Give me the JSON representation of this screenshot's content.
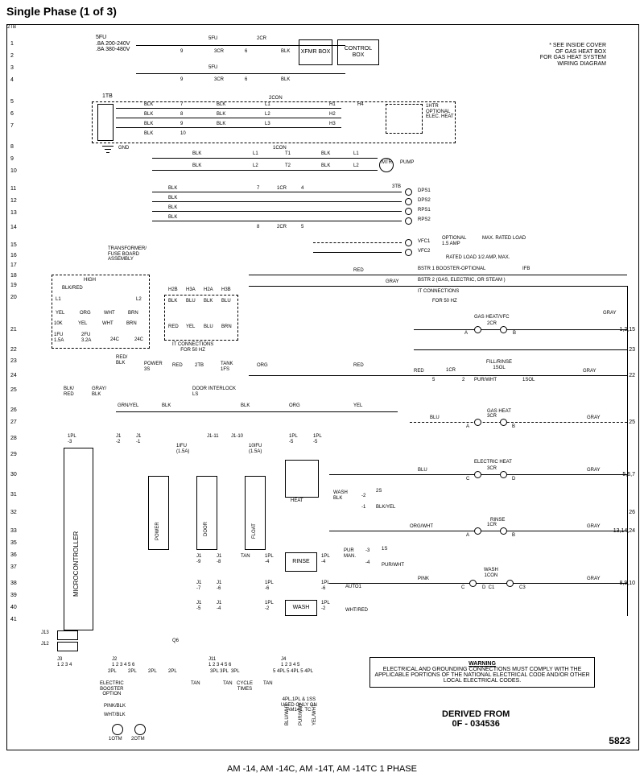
{
  "title": "Single Phase (1 of 3)",
  "footer": "AM -14, AM -14C, AM -14T, AM -14TC 1 PHASE",
  "drawing_number": "5823",
  "derived": "DERIVED FROM\n0F - 034536",
  "note_top": "* SEE INSIDE COVER\nOF GAS HEAT BOX\nFOR GAS HEAT SYSTEM\nWIRING DIAGRAM",
  "warning": {
    "heading": "WARNING",
    "body": "ELECTRICAL AND GROUNDING CONNECTIONS MUST\nCOMPLY WITH THE APPLICABLE PORTIONS OF THE\nNATIONAL ELECTRICAL CODE AND/OR OTHER LOCAL\nELECTRICAL CODES."
  },
  "row_numbers_left": [
    "1",
    "2",
    "3",
    "4",
    "5",
    "6",
    "7",
    "8",
    "9",
    "10",
    "11",
    "12",
    "13",
    "14",
    "15",
    "16",
    "17",
    "18",
    "19",
    "20",
    "21",
    "22",
    "23",
    "24",
    "25",
    "26",
    "27",
    "28",
    "29",
    "30",
    "31",
    "32",
    "33",
    "35",
    "36",
    "37",
    "38",
    "39",
    "40",
    "41"
  ],
  "row_numbers_right": [
    "23",
    "1,2,15",
    "22",
    "25",
    "5,6,7",
    "26",
    "13,14,24",
    "8,9,10"
  ],
  "header_block": {
    "fuse": "5FU\n.8A 200-240V\n.8A 380-480V",
    "labels": [
      "5FU",
      "5FU",
      "2CR"
    ],
    "wires1": [
      "9",
      "3CR",
      "6",
      "BLK"
    ],
    "wires2": [
      "9",
      "3CR",
      "6",
      "BLK"
    ],
    "xfmr": "XFMR\nBOX",
    "control": "CONTROL\nBOX"
  },
  "tb": {
    "name": "1TB",
    "rows": [
      "BLK",
      "BLK",
      "BLK",
      "BLK"
    ],
    "numbers": [
      "7",
      "8",
      "9",
      "10"
    ],
    "right": [
      "BLK",
      "BLK",
      "BLK",
      "BLK"
    ],
    "con": "2CON",
    "l123": [
      "L1",
      "L2",
      "L3"
    ],
    "h123": [
      "H1",
      "H2",
      "H3"
    ],
    "h4": "H4",
    "htr": "1HTR\nOPTIONAL\nELEC. HEAT",
    "gnd": "GND"
  },
  "midblock": {
    "con": "1CON",
    "lines": [
      [
        "BLK",
        "L1",
        "T1",
        "BLK",
        "L1"
      ],
      [
        "BLK",
        "L2",
        "T2",
        "BLK",
        "L2"
      ]
    ],
    "mtr": "MTR",
    "pump": "PUMP"
  },
  "dps_block": {
    "name": "3TB",
    "items": [
      "DPS1",
      "DPS2",
      "RPS1",
      "RPS2"
    ],
    "wires": [
      "BLK",
      "BLK",
      "BLK",
      "BLK"
    ],
    "mid": [
      "7",
      "1CR",
      "4",
      "8",
      "2CR",
      "5"
    ]
  },
  "vfc": {
    "v1": "VFC1",
    "v2": "VFC2",
    "opt": "OPTIONAL\n1.5 AMP",
    "max": "MAX. RATED LOAD",
    "line2": "RATED LOAD 1/2 AMP, MAX."
  },
  "bstr": {
    "b1": "BSTR 1 BOOSTER-OPTIONAL",
    "b2": "BSTR 2 (GAS, ELECTRIC, OR STEAM )",
    "b3": "IT CONNECTIONS",
    "b4": "FOR 50 HZ"
  },
  "transformer": {
    "title": "TRANSFORMER/\nFUSE BOARD\nASSEMBLY",
    "high": "HIGH",
    "blkred": "BLK/RED",
    "l1l2": [
      "L1",
      "L2"
    ],
    "sub": [
      "YEL",
      "ORG",
      "WHT",
      "BRN"
    ],
    "sub2": [
      "10K",
      "YEL",
      "WHT",
      "BRN"
    ],
    "fuses": [
      "1FU\n1.5A",
      "2FU\n3.2A",
      "24C",
      "24C"
    ],
    "small": "24C"
  },
  "h2b": {
    "cols": [
      "H2B",
      "H3A",
      "H2A",
      "H3B"
    ],
    "row": [
      "BLK",
      "BLU",
      "BLK",
      "BLU"
    ],
    "sec": [
      "RED",
      "YEL",
      "BLU",
      "BRN"
    ],
    "note": "IT CONNECTIONS\nFOR 50 HZ"
  },
  "power_row": {
    "left": [
      "RED/\nBLK",
      "POWER\n3S",
      "RED",
      "2TB",
      "TANK\n1FS",
      "ORG"
    ],
    "right": "RED",
    "row24": [
      "BLK/\nRED",
      "GRAY/\nBLK",
      "DOOR INTERLOCK\nLS"
    ],
    "row25": [
      "GRN/YEL",
      "BLK",
      "2TB",
      "BLK",
      "ORG",
      "YEL"
    ]
  },
  "micro": {
    "label": "MICROCONTROLLER",
    "top": [
      "1PL\n-3",
      "J1\n-2",
      "J1\n-1",
      "1IFU\n(1.5A)",
      "J1-11",
      "J1-10",
      "10IFU\n(1.5A)",
      "1PL\n-5",
      "1PL\n-5"
    ],
    "col_boxes": [
      "POWER",
      "DOOR",
      "FLOAT",
      "HEAT"
    ],
    "right_notes": [
      "WASH\nBLK",
      "-2",
      "2S",
      "-1",
      "BLK/YEL"
    ],
    "rinse": [
      "J1\n-9",
      "J1\n-8",
      "TAN",
      "1PL\n-4",
      "RINSE",
      "1PL\n-4"
    ],
    "purman": [
      "PUR\nMAN.",
      "-3",
      "1S",
      "-4",
      "PUR/WHT"
    ],
    "auto": [
      "J1\n-7",
      "J1\n-6",
      "1PL\n-6",
      "1PL\n-6",
      "AUTO1"
    ],
    "wash": [
      "J1\n-5",
      "J1\n-4",
      "1PL\n-2",
      "WASH",
      "1PL\n-2"
    ],
    "bottom_notes": "WHT/RED"
  },
  "right_rail": {
    "items": [
      {
        "title": "GAS HEAT/VFC",
        "a": "A",
        "b": "B",
        "cr": "2CR",
        "wire": "GRAY"
      },
      {
        "title": "FILL/RINSE\n1SOL",
        "a": "5",
        "b": "1CR",
        "c": "2",
        "wire": "RED",
        "wc": "PUR/WHT",
        "wd": "1SOL",
        "we": "GRAY"
      },
      {
        "title": "GAS HEAT",
        "a": "A",
        "b": "B",
        "cr": "3CR",
        "wire": "BLU",
        "wr": "GRAY"
      },
      {
        "title": "ELECTRIC HEAT",
        "a": "C",
        "b": "D",
        "cr": "3CR",
        "wire": "BLU",
        "wr": "GRAY"
      },
      {
        "title": "RINSE",
        "a": "A",
        "b": "B",
        "cr": "1CR",
        "wire": "ORG/WHT",
        "wr": "GRAY"
      },
      {
        "title": "WASH\n1CON",
        "a": "C",
        "b": "D  C1",
        "cr": "C3",
        "wire": "PINK",
        "wr": "GRAY"
      }
    ],
    "ifb": "IFB",
    "red_gray": [
      "RED",
      "GRAY"
    ]
  },
  "bottom": {
    "j13": "J13",
    "j12": "J12",
    "j3": "J3\n1 2 3 4",
    "j2": "J2\n1 2 3 4 5 6",
    "q6": "Q6",
    "j11": "J11\n1 2 3 4 5 6",
    "j4": "J4\n1 2 3 4 5",
    "plugs": [
      "2PL",
      "2PL",
      "2PL",
      "2PL",
      "3PL 3PL  3PL",
      "5 4PL 5 4PL 5 4PL"
    ],
    "opt1": "ELECTRIC\nBOOSTER\nOPTION",
    "cyc": "CYCLE\nTIMES",
    "tans": [
      "TAN",
      "TAN",
      "TAN"
    ],
    "pinkblk": "PINK/BLK",
    "whtblk": "WHT/BLK",
    "tenTM": "1OTM",
    "twentyTM": "2OTM",
    "rot": [
      "BLU/WHT",
      "PUR/WHT",
      "YEL/WHT"
    ],
    "note": "4PL,1PL & 1SS\nUSED ONLY ON\nAM14T, TC"
  }
}
